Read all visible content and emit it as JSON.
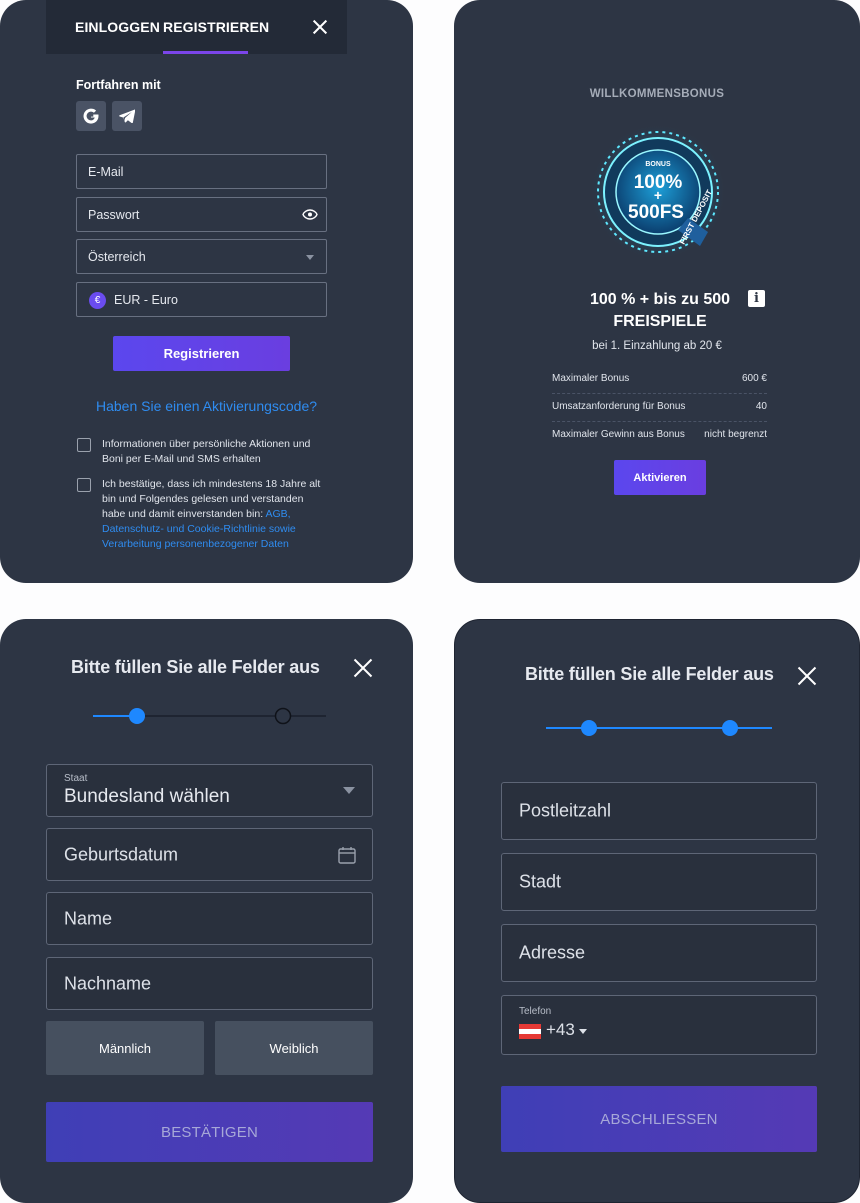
{
  "login_panel": {
    "tabs": [
      "EINLOGGEN",
      "REGISTRIEREN"
    ],
    "continue_with": "Fortfahren mit",
    "email_placeholder": "E-Mail",
    "password_placeholder": "Passwort",
    "country_value": "Österreich",
    "currency_value": "EUR - Euro",
    "currency_symbol": "€",
    "register_button": "Registrieren",
    "activation_link": "Haben Sie einen Aktivierungscode?",
    "checkbox_promo": "Informationen über persönliche Aktionen und Boni per E-Mail und SMS erhalten",
    "checkbox_terms_text": "Ich bestätige, dass ich mindestens 18 Jahre alt bin und Folgendes gelesen und verstanden habe und damit einverstanden bin:",
    "checkbox_terms_links": "AGB, Datenschutz- und Cookie-Richtlinie sowie Verarbeitung personenbezogener Daten"
  },
  "bonus_panel": {
    "heading": "WILLKOMMENSBONUS",
    "badge_top": "BONUS",
    "badge_line1": "100%",
    "badge_plus": "+",
    "badge_line2": "500FS",
    "badge_ribbon": "FIRST DEPOSIT",
    "title": "100 % + bis zu 500 FREISPIELE",
    "subtitle": "bei 1. Einzahlung ab 20 €",
    "rows": [
      {
        "key": "Maximaler Bonus",
        "value": "600 €"
      },
      {
        "key": "Umsatzanforderung für Bonus",
        "value": "40"
      },
      {
        "key": "Maximaler Gewinn aus Bonus",
        "value": "nicht begrenzt"
      }
    ],
    "activate_button": "Aktivieren"
  },
  "step1_panel": {
    "title": "Bitte füllen Sie alle Felder aus",
    "state_label": "Staat",
    "state_value": "Bundesland wählen",
    "birthdate_placeholder": "Geburtsdatum",
    "name_placeholder": "Name",
    "surname_placeholder": "Nachname",
    "male": "Männlich",
    "female": "Weiblich",
    "confirm_button": "BESTÄTIGEN"
  },
  "step2_panel": {
    "title": "Bitte füllen Sie alle Felder aus",
    "postcode_placeholder": "Postleitzahl",
    "city_placeholder": "Stadt",
    "address_placeholder": "Adresse",
    "phone_label": "Telefon",
    "phone_code": "+43",
    "finish_button": "ABSCHLIESSEN"
  },
  "colors": {
    "panel_bg": "#2d3544",
    "accent_purple": "#5b47ee",
    "link_blue": "#2f8cf0",
    "step_blue": "#1e88ff"
  }
}
